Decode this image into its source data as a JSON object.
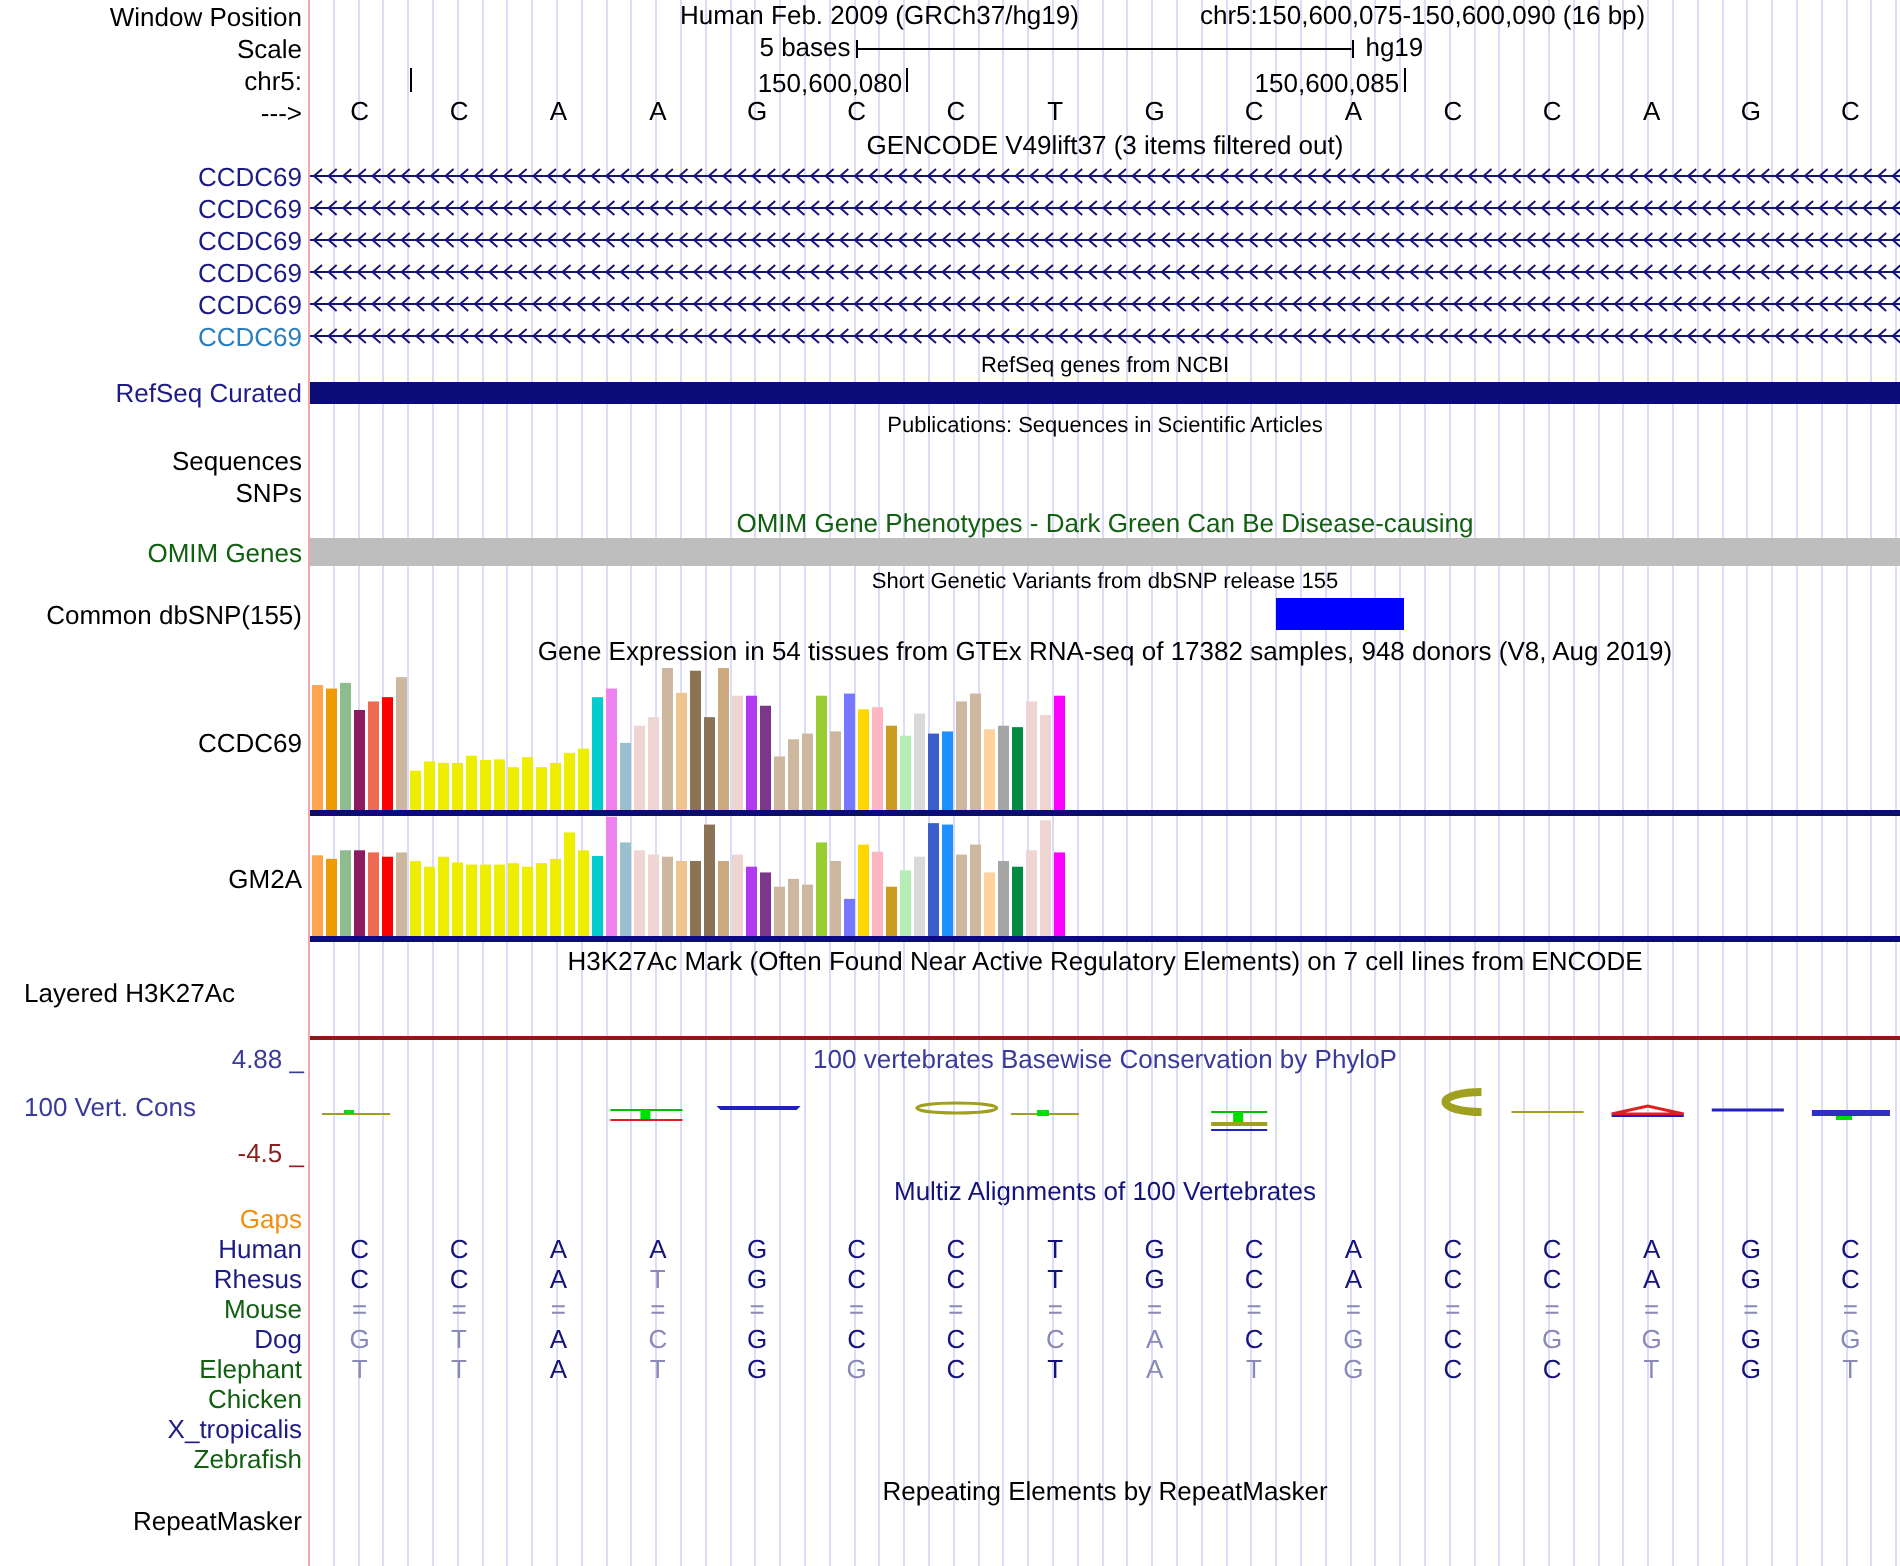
{
  "position": {
    "label": "Window Position",
    "assembly": "Human Feb. 2009 (GRCh37/hg19)",
    "range": "chr5:150,600,075-150,600,090 (16 bp)"
  },
  "scale": {
    "label": "Scale",
    "span": "5 bases",
    "assembly": "hg19"
  },
  "ruler": {
    "label": "chr5:",
    "ticks": [
      "150,600,080",
      "150,600,085"
    ]
  },
  "sequence": {
    "label": "--->",
    "bases": [
      "C",
      "C",
      "A",
      "A",
      "G",
      "C",
      "C",
      "T",
      "G",
      "C",
      "A",
      "C",
      "C",
      "A",
      "G",
      "C"
    ]
  },
  "gencode": {
    "title": "GENCODE V49lift37 (3 items filtered out)",
    "genes": [
      {
        "name": "CCDC69",
        "color": "#1c1c84"
      },
      {
        "name": "CCDC69",
        "color": "#1c1c84"
      },
      {
        "name": "CCDC69",
        "color": "#1c1c84"
      },
      {
        "name": "CCDC69",
        "color": "#1c1c84"
      },
      {
        "name": "CCDC69",
        "color": "#1c1c84"
      },
      {
        "name": "CCDC69",
        "color": "#2a7fc0"
      }
    ]
  },
  "refseq": {
    "title": "RefSeq genes from NCBI",
    "label": "RefSeq Curated"
  },
  "publications": {
    "title": "Publications: Sequences in Scientific Articles",
    "labels": [
      "Sequences",
      "SNPs"
    ]
  },
  "omim": {
    "title": "OMIM Gene Phenotypes - Dark Green Can Be Disease-causing",
    "label": "OMIM Genes"
  },
  "dbsnp": {
    "title": "Short Genetic Variants from dbSNP release 155",
    "label": "Common dbSNP(155)"
  },
  "gtex": {
    "title": "Gene Expression in 54 tissues from GTEx RNA-seq of 17382 samples, 948 donors (V8, Aug 2019)",
    "genes": [
      "CCDC69",
      "GM2A"
    ]
  },
  "h3k27ac": {
    "title": "H3K27Ac Mark (Often Found Near Active Regulatory Elements) on 7 cell lines from ENCODE",
    "label": "Layered H3K27Ac"
  },
  "phylop": {
    "title": "100 vertebrates Basewise Conservation by PhyloP",
    "label": "100 Vert. Cons",
    "max": "4.88 _",
    "min": "-4.5 _"
  },
  "multiz": {
    "title": "Multiz Alignments of 100 Vertebrates",
    "gaps_label": "Gaps",
    "species": [
      {
        "name": "Human",
        "color": "#1c1c84",
        "bases": [
          {
            "base": "C",
            "match": true
          },
          {
            "base": "C",
            "match": true
          },
          {
            "base": "A",
            "match": true
          },
          {
            "base": "A",
            "match": true
          },
          {
            "base": "G",
            "match": true
          },
          {
            "base": "C",
            "match": true
          },
          {
            "base": "C",
            "match": true
          },
          {
            "base": "T",
            "match": true
          },
          {
            "base": "G",
            "match": true
          },
          {
            "base": "C",
            "match": true
          },
          {
            "base": "A",
            "match": true
          },
          {
            "base": "C",
            "match": true
          },
          {
            "base": "C",
            "match": true
          },
          {
            "base": "A",
            "match": true
          },
          {
            "base": "G",
            "match": true
          },
          {
            "base": "C",
            "match": true
          }
        ]
      },
      {
        "name": "Rhesus",
        "color": "#1c1c84",
        "bases": [
          {
            "base": "C",
            "match": true
          },
          {
            "base": "C",
            "match": true
          },
          {
            "base": "A",
            "match": true
          },
          {
            "base": "T",
            "match": false
          },
          {
            "base": "G",
            "match": true
          },
          {
            "base": "C",
            "match": true
          },
          {
            "base": "C",
            "match": true
          },
          {
            "base": "T",
            "match": true
          },
          {
            "base": "G",
            "match": true
          },
          {
            "base": "C",
            "match": true
          },
          {
            "base": "A",
            "match": true
          },
          {
            "base": "C",
            "match": true
          },
          {
            "base": "C",
            "match": true
          },
          {
            "base": "A",
            "match": true
          },
          {
            "base": "G",
            "match": true
          },
          {
            "base": "C",
            "match": true
          }
        ]
      },
      {
        "name": "Mouse",
        "color": "#106010",
        "bases": [
          {
            "base": "=",
            "match": false
          },
          {
            "base": "=",
            "match": false
          },
          {
            "base": "=",
            "match": false
          },
          {
            "base": "=",
            "match": false
          },
          {
            "base": "=",
            "match": false
          },
          {
            "base": "=",
            "match": false
          },
          {
            "base": "=",
            "match": false
          },
          {
            "base": "=",
            "match": false
          },
          {
            "base": "=",
            "match": false
          },
          {
            "base": "=",
            "match": false
          },
          {
            "base": "=",
            "match": false
          },
          {
            "base": "=",
            "match": false
          },
          {
            "base": "=",
            "match": false
          },
          {
            "base": "=",
            "match": false
          },
          {
            "base": "=",
            "match": false
          },
          {
            "base": "=",
            "match": false
          }
        ]
      },
      {
        "name": "Dog",
        "color": "#1c1c84",
        "bases": [
          {
            "base": "G",
            "match": false
          },
          {
            "base": "T",
            "match": false
          },
          {
            "base": "A",
            "match": true
          },
          {
            "base": "C",
            "match": false
          },
          {
            "base": "G",
            "match": true
          },
          {
            "base": "C",
            "match": true
          },
          {
            "base": "C",
            "match": true
          },
          {
            "base": "C",
            "match": false
          },
          {
            "base": "A",
            "match": false
          },
          {
            "base": "C",
            "match": true
          },
          {
            "base": "G",
            "match": false
          },
          {
            "base": "C",
            "match": true
          },
          {
            "base": "G",
            "match": false
          },
          {
            "base": "G",
            "match": false
          },
          {
            "base": "G",
            "match": true
          },
          {
            "base": "G",
            "match": false
          }
        ]
      },
      {
        "name": "Elephant",
        "color": "#106010",
        "bases": [
          {
            "base": "T",
            "match": false
          },
          {
            "base": "T",
            "match": false
          },
          {
            "base": "A",
            "match": true
          },
          {
            "base": "T",
            "match": false
          },
          {
            "base": "G",
            "match": true
          },
          {
            "base": "G",
            "match": false
          },
          {
            "base": "C",
            "match": true
          },
          {
            "base": "T",
            "match": true
          },
          {
            "base": "A",
            "match": false
          },
          {
            "base": "T",
            "match": false
          },
          {
            "base": "G",
            "match": false
          },
          {
            "base": "C",
            "match": true
          },
          {
            "base": "C",
            "match": true
          },
          {
            "base": "T",
            "match": false
          },
          {
            "base": "G",
            "match": true
          },
          {
            "base": "T",
            "match": false
          }
        ]
      },
      {
        "name": "Chicken",
        "color": "#106010"
      },
      {
        "name": "X_tropicalis",
        "color": "#1c1c84"
      },
      {
        "name": "Zebrafish",
        "color": "#106010"
      }
    ]
  },
  "repeatmasker": {
    "title": "Repeating Elements by RepeatMasker",
    "label": "RepeatMasker"
  }
}
